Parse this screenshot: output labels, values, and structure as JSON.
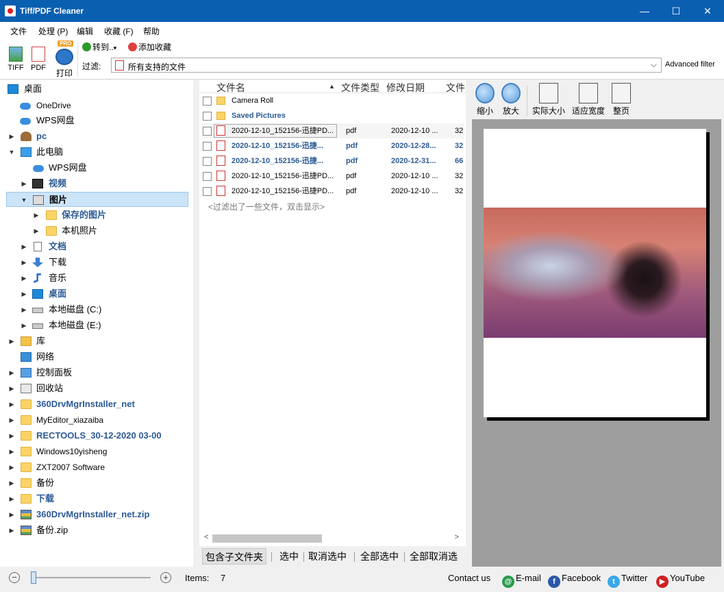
{
  "window": {
    "title": "Tiff/PDF Cleaner",
    "minimize": "—",
    "maximize": "☐",
    "close": "✕"
  },
  "menu": [
    "文件",
    "处理 (P)",
    "编辑",
    "收藏 (F)",
    "帮助"
  ],
  "toolbar": {
    "tiff": "TIFF",
    "pdf": "PDF",
    "print": "打印",
    "pro_badge": "PRO",
    "goto": "转到..",
    "goto_arrow": "▾",
    "add_favorite": "添加收藏",
    "filter_label": "过滤:",
    "filter_value": "所有支持的文件",
    "advanced_filter": "Advanced filter"
  },
  "tree": {
    "items": [
      {
        "label": "桌面",
        "arrow": ""
      },
      {
        "label": "OneDrive",
        "arrow": ""
      },
      {
        "label": "WPS网盘",
        "arrow": ""
      },
      {
        "label": "pc",
        "arrow": "▶"
      },
      {
        "label": "此电脑",
        "arrow": "▼"
      },
      {
        "label": "WPS网盘",
        "arrow": ""
      },
      {
        "label": "视频",
        "arrow": "▶"
      },
      {
        "label": "图片",
        "arrow": "▼"
      },
      {
        "label": "保存的图片",
        "arrow": "▶"
      },
      {
        "label": "本机照片",
        "arrow": "▶"
      },
      {
        "label": "文档",
        "arrow": "▶"
      },
      {
        "label": "下载",
        "arrow": "▶"
      },
      {
        "label": "音乐",
        "arrow": "▶"
      },
      {
        "label": "桌面",
        "arrow": "▶"
      },
      {
        "label": "本地磁盘 (C:)",
        "arrow": "▶"
      },
      {
        "label": "本地磁盘 (E:)",
        "arrow": "▶"
      },
      {
        "label": "库",
        "arrow": "▶"
      },
      {
        "label": "网络",
        "arrow": ""
      },
      {
        "label": "控制面板",
        "arrow": "▶"
      },
      {
        "label": "回收站",
        "arrow": "▶"
      },
      {
        "label": "360DrvMgrInstaller_net",
        "arrow": "▶"
      },
      {
        "label": "MyEditor_xiazaiba",
        "arrow": "▶"
      },
      {
        "label": "RECTOOLS_30-12-2020 03-00",
        "arrow": "▶"
      },
      {
        "label": "Windows10yisheng",
        "arrow": "▶"
      },
      {
        "label": "ZXT2007 Software",
        "arrow": "▶"
      },
      {
        "label": "备份",
        "arrow": "▶"
      },
      {
        "label": "下载",
        "arrow": "▶"
      },
      {
        "label": "360DrvMgrInstaller_net.zip",
        "arrow": "▶"
      },
      {
        "label": "备份.zip",
        "arrow": "▶"
      }
    ]
  },
  "files": {
    "columns": {
      "name": "文件名",
      "sort_arrow": "▲",
      "type": "文件类型",
      "date": "修改日期",
      "size": "文件"
    },
    "rows": [
      {
        "name": "Camera Roll",
        "type": "",
        "date": "",
        "size": ""
      },
      {
        "name": "Saved Pictures",
        "type": "",
        "date": "",
        "size": ""
      },
      {
        "name": "2020-12-10_152156-迅捷PD...",
        "type": "pdf",
        "date": "2020-12-10 ...",
        "size": "32"
      },
      {
        "name": "2020-12-10_152156-迅捷...",
        "type": "pdf",
        "date": "2020-12-28...",
        "size": "32"
      },
      {
        "name": "2020-12-10_152156-迅捷...",
        "type": "pdf",
        "date": "2020-12-31...",
        "size": "66"
      },
      {
        "name": "2020-12-10_152156-迅捷PD...",
        "type": "pdf",
        "date": "2020-12-10 ...",
        "size": "32"
      },
      {
        "name": "2020-12-10_152156-迅捷PD...",
        "type": "pdf",
        "date": "2020-12-10 ...",
        "size": "32"
      }
    ],
    "filtered_note": "<过滤出了一些文件，双击显示>",
    "scroll_left": "<",
    "scroll_right": ">",
    "buttons": {
      "include_subfolders": "包含子文件夹",
      "select": "选中",
      "deselect": "取消选中",
      "select_all": "全部选中",
      "deselect_all": "全部取消选"
    }
  },
  "preview": {
    "zoom_out": "缩小",
    "zoom_in": "放大",
    "actual_size": "实际大小",
    "fit_width": "适应宽度",
    "whole_page": "整页"
  },
  "status": {
    "minus": "−",
    "plus": "+",
    "items_label": "Items:",
    "items_count": "7",
    "contact": "Contact us",
    "email": "E-mail",
    "facebook": "Facebook",
    "twitter": "Twitter",
    "youtube": "YouTube"
  }
}
